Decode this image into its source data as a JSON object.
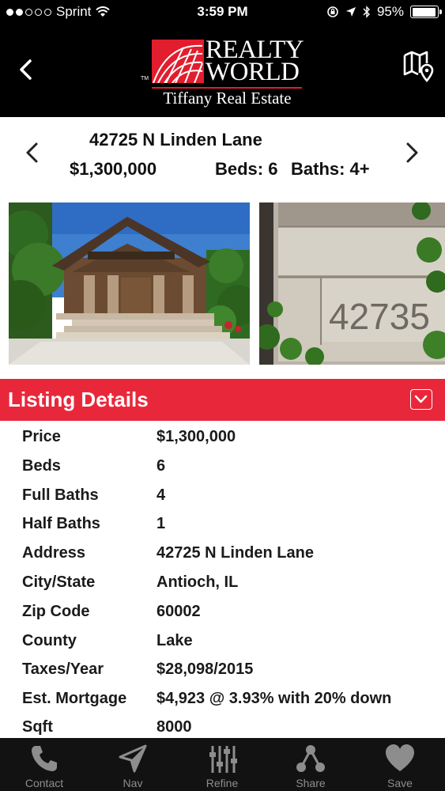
{
  "status_bar": {
    "carrier": "Sprint",
    "time": "3:59 PM",
    "battery": "95%",
    "battery_level": 0.95,
    "signal_bars": 2
  },
  "header": {
    "logo_line1": "REALTY",
    "logo_line2": "WORLD",
    "logo_tagline": "Tiffany Real Estate",
    "logo_tm": "TM",
    "brand_color": "#e21d2d",
    "back_icon": "chevron-left-icon",
    "map_icon": "map-pin-icon"
  },
  "listing": {
    "street": "42725 N Linden Lane",
    "price": "$1,300,000",
    "beds": "Beds: 6",
    "baths": "Baths: 4+",
    "photo2_number": "42735"
  },
  "section": {
    "title": "Listing Details",
    "accent": "#e8283a"
  },
  "details": [
    {
      "label": "Price",
      "value": "$1,300,000"
    },
    {
      "label": "Beds",
      "value": "6"
    },
    {
      "label": "Full Baths",
      "value": "4"
    },
    {
      "label": "Half Baths",
      "value": "1"
    },
    {
      "label": "Address",
      "value": "42725 N Linden Lane"
    },
    {
      "label": "City/State",
      "value": "Antioch, IL"
    },
    {
      "label": "Zip Code",
      "value": "60002"
    },
    {
      "label": "County",
      "value": "Lake"
    },
    {
      "label": "Taxes/Year",
      "value": "$28,098/2015"
    },
    {
      "label": "Est. Mortgage",
      "value": "$4,923 @ 3.93% with 20% down"
    },
    {
      "label": "Sqft",
      "value": "8000"
    }
  ],
  "tabs": [
    {
      "label": "Contact",
      "icon": "phone-icon"
    },
    {
      "label": "Nav",
      "icon": "navigation-arrow-icon"
    },
    {
      "label": "Refine",
      "icon": "sliders-icon"
    },
    {
      "label": "Share",
      "icon": "share-icon"
    },
    {
      "label": "Save",
      "icon": "heart-icon"
    }
  ]
}
